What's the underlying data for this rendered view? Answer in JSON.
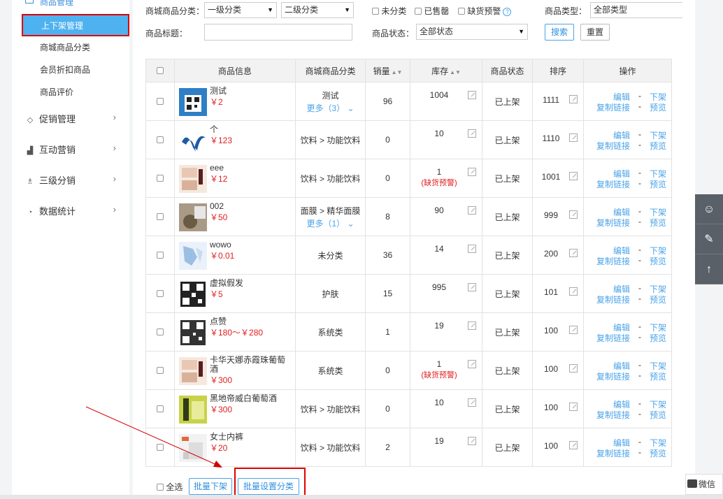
{
  "sidebar": {
    "top_label": "商品管理",
    "active": "上下架管理",
    "subs": [
      "商城商品分类",
      "会员折扣商品",
      "商品评价"
    ],
    "groups": [
      "促销管理",
      "互动营销",
      "三级分销",
      "数据统计"
    ]
  },
  "filters": {
    "cat_label": "商城商品分类：",
    "cat1": "一级分类",
    "cat2": "二级分类",
    "chk_uncat": "未分类",
    "chk_sold": "已售罄",
    "chk_low": "缺货预警",
    "type_label": "商品类型：",
    "type_value": "全部类型",
    "title_label": "商品标题：",
    "title_value": "",
    "status_label": "商品状态：",
    "status_value": "全部状态",
    "search": "搜索",
    "reset": "重置"
  },
  "table": {
    "headers": [
      "商品信息",
      "商城商品分类",
      "销量",
      "库存",
      "商品状态",
      "排序",
      "操作"
    ],
    "rows": [
      {
        "name": "测试",
        "price": "￥2",
        "cat": "测试",
        "more": "更多（3）",
        "sales": "96",
        "stock": "1004",
        "warn": "",
        "status": "已上架",
        "sort": "1111"
      },
      {
        "name": "个",
        "price": "￥123",
        "cat": "饮料 > 功能饮料",
        "more": "",
        "sales": "0",
        "stock": "10",
        "warn": "",
        "status": "已上架",
        "sort": "1110"
      },
      {
        "name": "eee",
        "price": "￥12",
        "cat": "饮料 > 功能饮料",
        "more": "",
        "sales": "0",
        "stock": "1",
        "warn": "(缺货预警)",
        "status": "已上架",
        "sort": "1001"
      },
      {
        "name": "002",
        "price": "￥50",
        "cat": "面膜 > 精华面膜",
        "more": "更多（1）",
        "sales": "8",
        "stock": "90",
        "warn": "",
        "status": "已上架",
        "sort": "999"
      },
      {
        "name": "wowo",
        "price": "￥0.01",
        "cat": "未分类",
        "more": "",
        "sales": "36",
        "stock": "14",
        "warn": "",
        "status": "已上架",
        "sort": "200"
      },
      {
        "name": "虚拟假发",
        "price": "￥5",
        "cat": "护肤",
        "more": "",
        "sales": "15",
        "stock": "995",
        "warn": "",
        "status": "已上架",
        "sort": "101"
      },
      {
        "name": "点赞",
        "price": "￥180～￥280",
        "cat": "系统类",
        "more": "",
        "sales": "1",
        "stock": "19",
        "warn": "",
        "status": "已上架",
        "sort": "100"
      },
      {
        "name": "卡华天娜赤霞珠葡萄酒",
        "price": "￥300",
        "cat": "系统类",
        "more": "",
        "sales": "0",
        "stock": "1",
        "warn": "(缺货预警)",
        "status": "已上架",
        "sort": "100"
      },
      {
        "name": "黑地帝威白葡萄酒",
        "price": "￥300",
        "cat": "饮料 > 功能饮料",
        "more": "",
        "sales": "0",
        "stock": "10",
        "warn": "",
        "status": "已上架",
        "sort": "100"
      },
      {
        "name": "女士内裤",
        "price": "￥20",
        "cat": "饮料 > 功能饮料",
        "more": "",
        "sales": "2",
        "stock": "19",
        "warn": "",
        "status": "已上架",
        "sort": "100"
      }
    ],
    "ops": {
      "edit": "编辑",
      "down": "下架",
      "copy": "复制链接",
      "preview": "预览"
    }
  },
  "bottom": {
    "select_all": "全选",
    "batch_down": "批量下架",
    "batch_cat": "批量设置分类"
  },
  "tools": {
    "wechat": "微信"
  }
}
